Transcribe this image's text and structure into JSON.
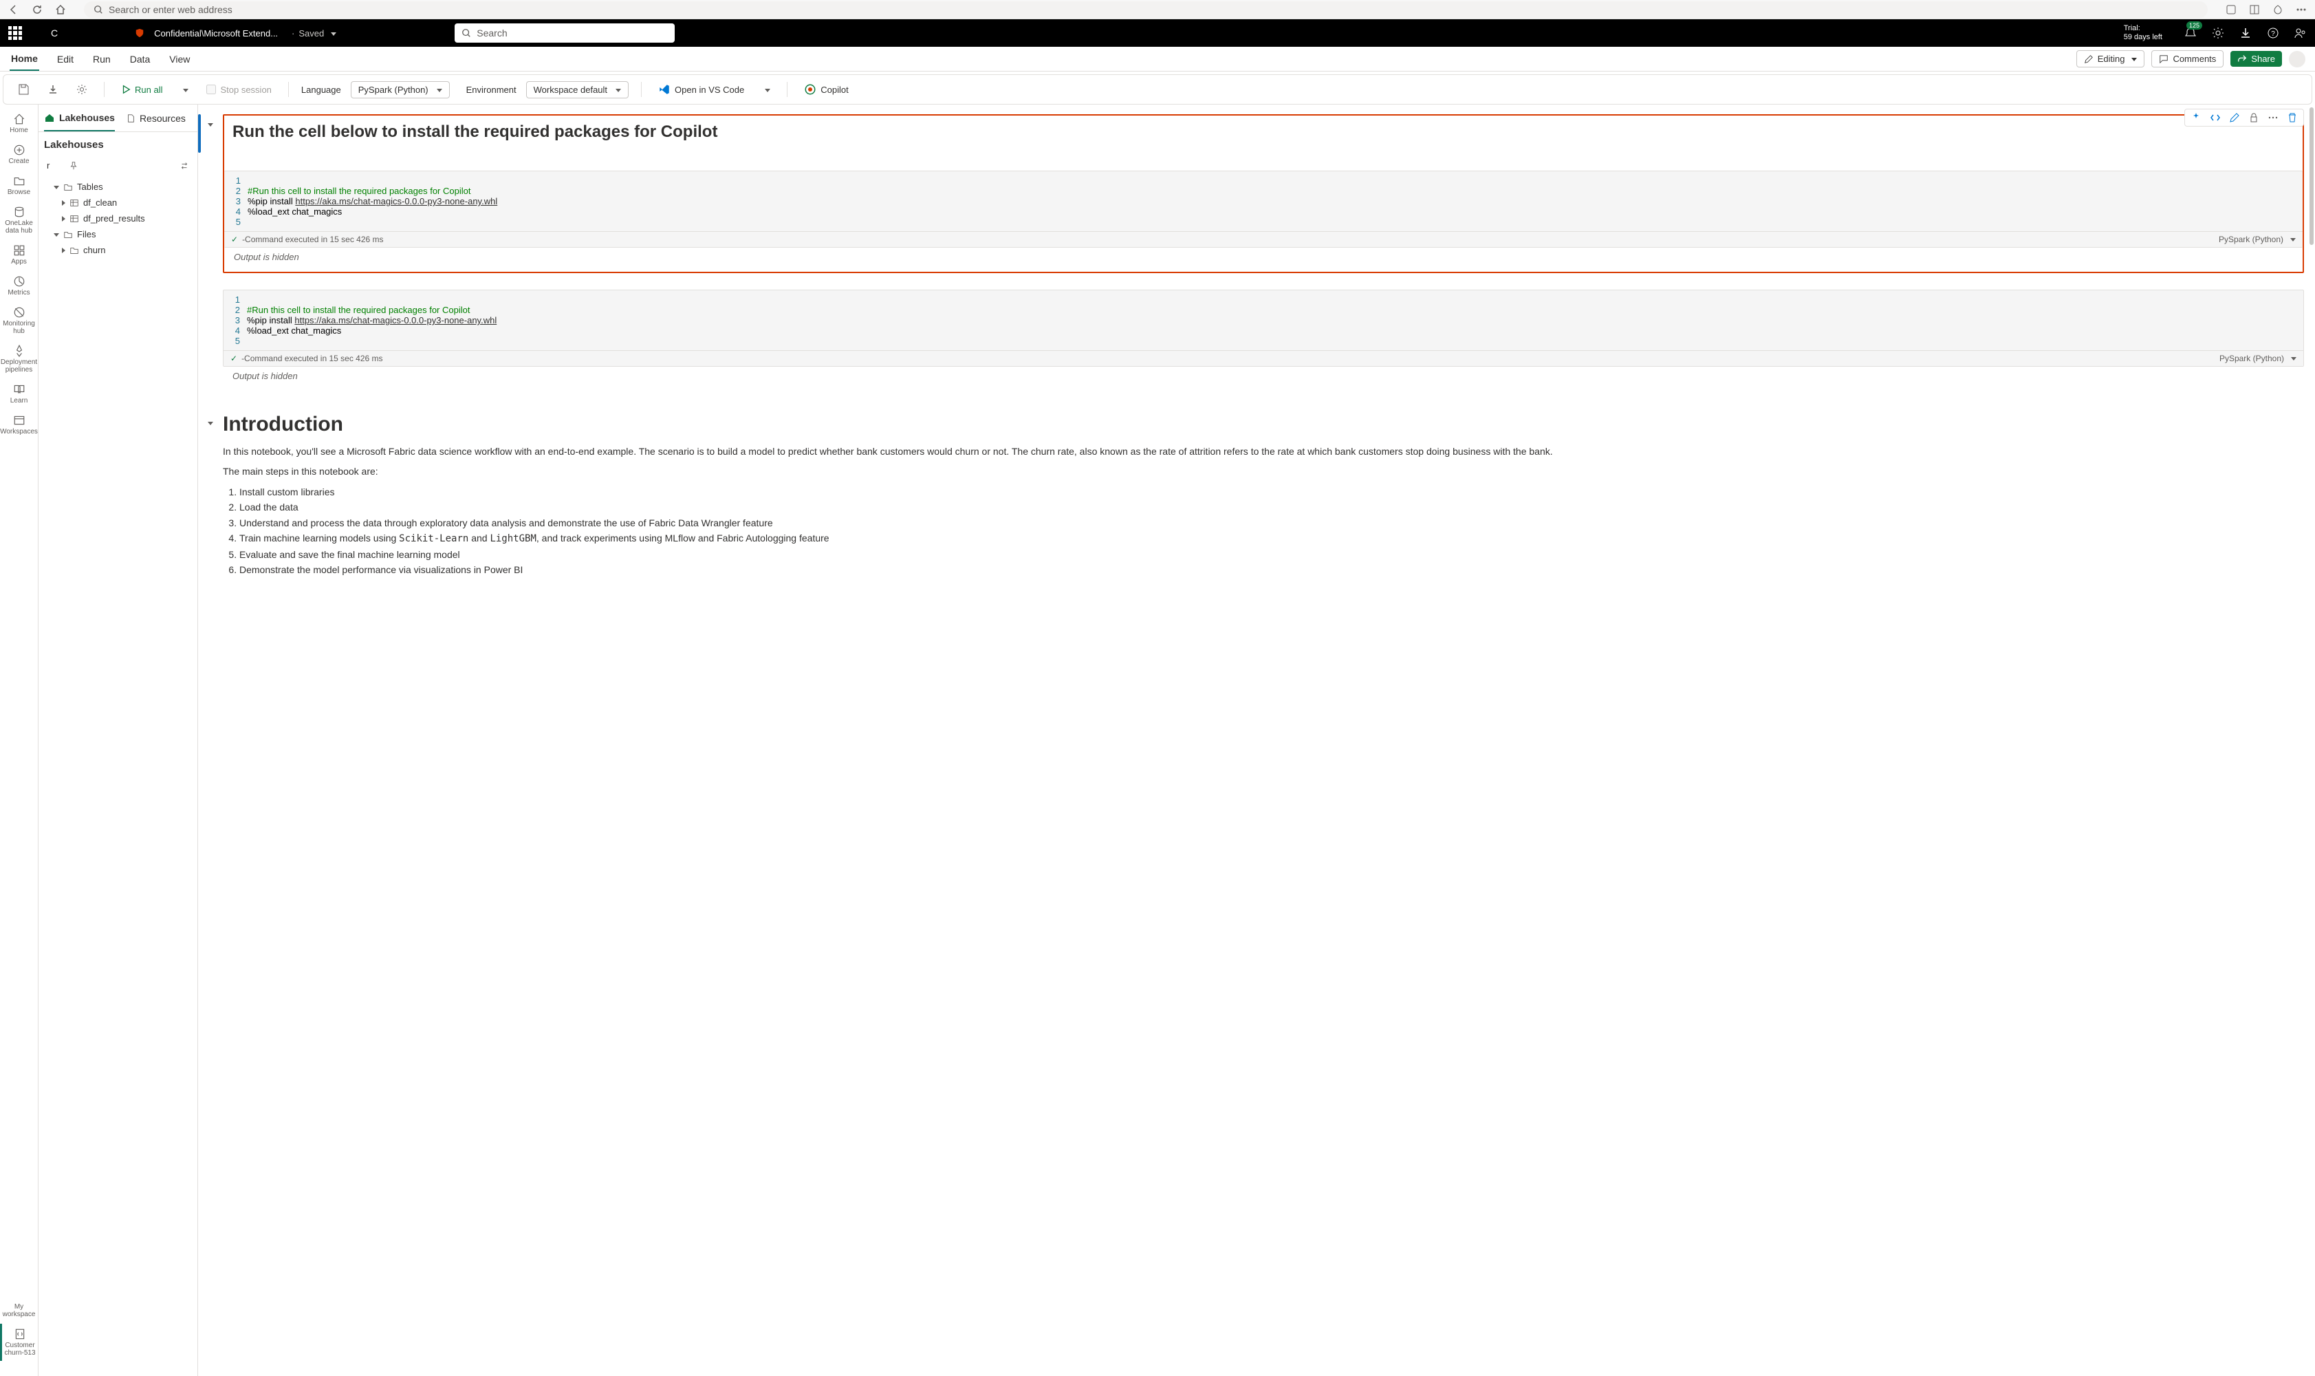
{
  "browser": {
    "address_placeholder": "Search or enter web address"
  },
  "topbar": {
    "c_label": "C",
    "doc_path": "Confidential\\Microsoft Extend...",
    "saved": "Saved",
    "search_placeholder": "Search",
    "trial_line1": "Trial:",
    "trial_line2": "59 days left",
    "notif_badge": "125"
  },
  "ribbon": {
    "tabs": [
      "Home",
      "Edit",
      "Run",
      "Data",
      "View"
    ],
    "editing": "Editing",
    "comments": "Comments",
    "share": "Share"
  },
  "toolbar": {
    "run_all": "Run all",
    "stop_session": "Stop session",
    "language_label": "Language",
    "language_value": "PySpark (Python)",
    "environment_label": "Environment",
    "environment_value": "Workspace default",
    "open_vscode": "Open in VS Code",
    "copilot": "Copilot"
  },
  "vnav": {
    "items": [
      "Home",
      "Create",
      "Browse",
      "OneLake data hub",
      "Apps",
      "Metrics",
      "Monitoring hub",
      "Deployment pipelines",
      "Learn",
      "Workspaces"
    ],
    "my_workspace": "My workspace",
    "notebook_item": "Customer churn-513"
  },
  "side": {
    "tab1": "Lakehouses",
    "tab2": "Resources",
    "header": "Lakehouses",
    "row_r": "r",
    "tree": {
      "tables": "Tables",
      "df_clean": "df_clean",
      "df_pred": "df_pred_results",
      "files": "Files",
      "churn": "churn"
    }
  },
  "cells": {
    "md_title": "Run the cell below to install the required packages for Copilot",
    "code_comment": "#Run this cell to install the required packages for Copilot",
    "pip_prefix": "%pip install ",
    "pip_url": "https://aka.ms/chat-magics-0.0.0-py3-none-any.whl",
    "load_ext": "%load_ext chat_magics",
    "exec_status": "-Command executed in 15 sec 426 ms",
    "lang_status": "PySpark (Python)",
    "output_hidden": "Output is hidden",
    "intro_title": "Introduction",
    "intro_p1": "In this notebook, you'll see a Microsoft Fabric data science workflow with an end-to-end example. The scenario is to build a model to predict whether bank customers would churn or not. The churn rate, also known as the rate of attrition refers to the rate at which bank customers stop doing business with the bank.",
    "intro_p2": "The main steps in this notebook are:",
    "steps": [
      "Install custom libraries",
      "Load the data",
      "Understand and process the data through exploratory data analysis and demonstrate the use of Fabric Data Wrangler feature",
      "Train machine learning models using Scikit-Learn and LightGBM, and track experiments using MLflow and Fabric Autologging feature",
      "Evaluate and save the final machine learning model",
      "Demonstrate the model performance via visualizations in Power BI"
    ],
    "scikit": "Scikit-Learn",
    "lightgbm": "LightGBM",
    "and_word": " and "
  }
}
